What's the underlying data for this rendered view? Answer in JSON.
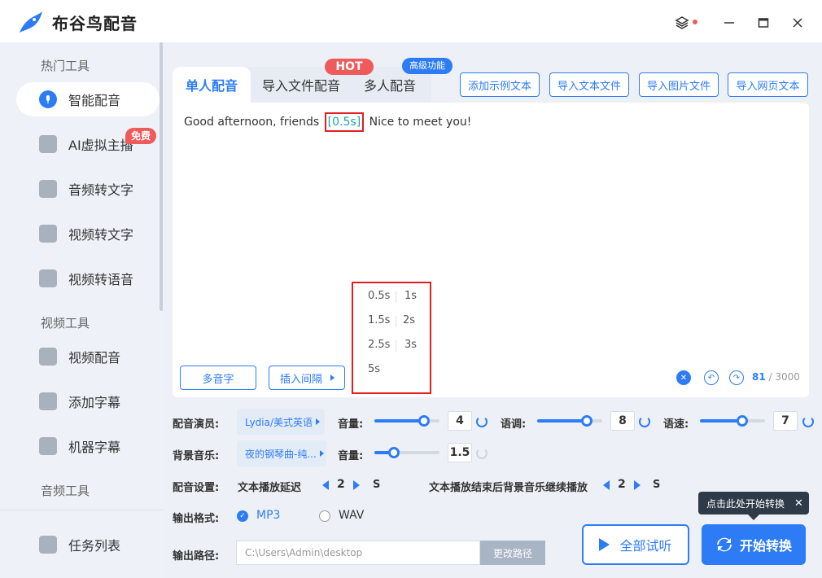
{
  "app": {
    "title": "布谷鸟配音"
  },
  "sidebar": {
    "sections": [
      "热门工具",
      "视频工具",
      "音频工具"
    ],
    "items": [
      {
        "label": "智能配音",
        "icon": "voice-icon",
        "active": true
      },
      {
        "label": "AI虚拟主播",
        "icon": "avatar-icon",
        "badge": "免费"
      },
      {
        "label": "音频转文字",
        "icon": "audio-text-icon"
      },
      {
        "label": "视频转文字",
        "icon": "video-text-icon"
      },
      {
        "label": "视频转语音",
        "icon": "video-voice-icon"
      },
      {
        "label": "视频配音",
        "icon": "video-dub-icon"
      },
      {
        "label": "添加字幕",
        "icon": "subtitle-icon"
      },
      {
        "label": "机器字幕",
        "icon": "robot-icon"
      }
    ],
    "task_list": "任务列表"
  },
  "tabs": [
    {
      "label": "单人配音",
      "active": true
    },
    {
      "label": "导入文件配音"
    },
    {
      "label": "多人配音"
    }
  ],
  "badges": {
    "hot": "HOT",
    "advanced": "高级功能"
  },
  "toolbar": [
    "添加示例文本",
    "导入文本文件",
    "导入图片文件",
    "导入网页文本"
  ],
  "editor": {
    "text_before": "Good afternoon, friends",
    "pause_tag": "[0.5s]",
    "text_after": "Nice to meet you!",
    "polyphone_btn": "多音字",
    "insert_pause_btn": "插入间隔",
    "char_count": "81",
    "char_max": "/ 3000"
  },
  "pause_options": [
    [
      "0.5s",
      "1s"
    ],
    [
      "1.5s",
      "2s"
    ],
    [
      "2.5s",
      "3s"
    ],
    [
      "5s"
    ]
  ],
  "settings": {
    "voice_label": "配音演员:",
    "voice_value": "Lydia/美式英语",
    "volume_label": "音量:",
    "volume_value": "4",
    "pitch_label": "语调:",
    "pitch_value": "8",
    "speed_label": "语速:",
    "speed_value": "7",
    "bgm_label": "背景音乐:",
    "bgm_value": "夜的钢琴曲-纯...",
    "bgm_volume_label": "音量:",
    "bgm_volume_value": "1.5",
    "config_label": "配音设置:",
    "delay_label": "文本播放延迟",
    "delay_value": "2",
    "delay_unit": "S",
    "continue_label": "文本播放结束后背景音乐继续播放",
    "continue_value": "2",
    "continue_unit": "S",
    "format_label": "输出格式:",
    "format_mp3": "MP3",
    "format_wav": "WAV",
    "path_label": "输出路径:",
    "path_value": "C:\\Users\\Admin\\desktop",
    "path_btn": "更改路径"
  },
  "actions": {
    "preview": "全部试听",
    "start": "开始转换",
    "tooltip": "点击此处开始转换"
  },
  "colors": {
    "accent": "#2d7cf6",
    "hot": "#ef5a5a",
    "highlight_border": "#e02020",
    "pause_tag": "#17a8a2"
  }
}
